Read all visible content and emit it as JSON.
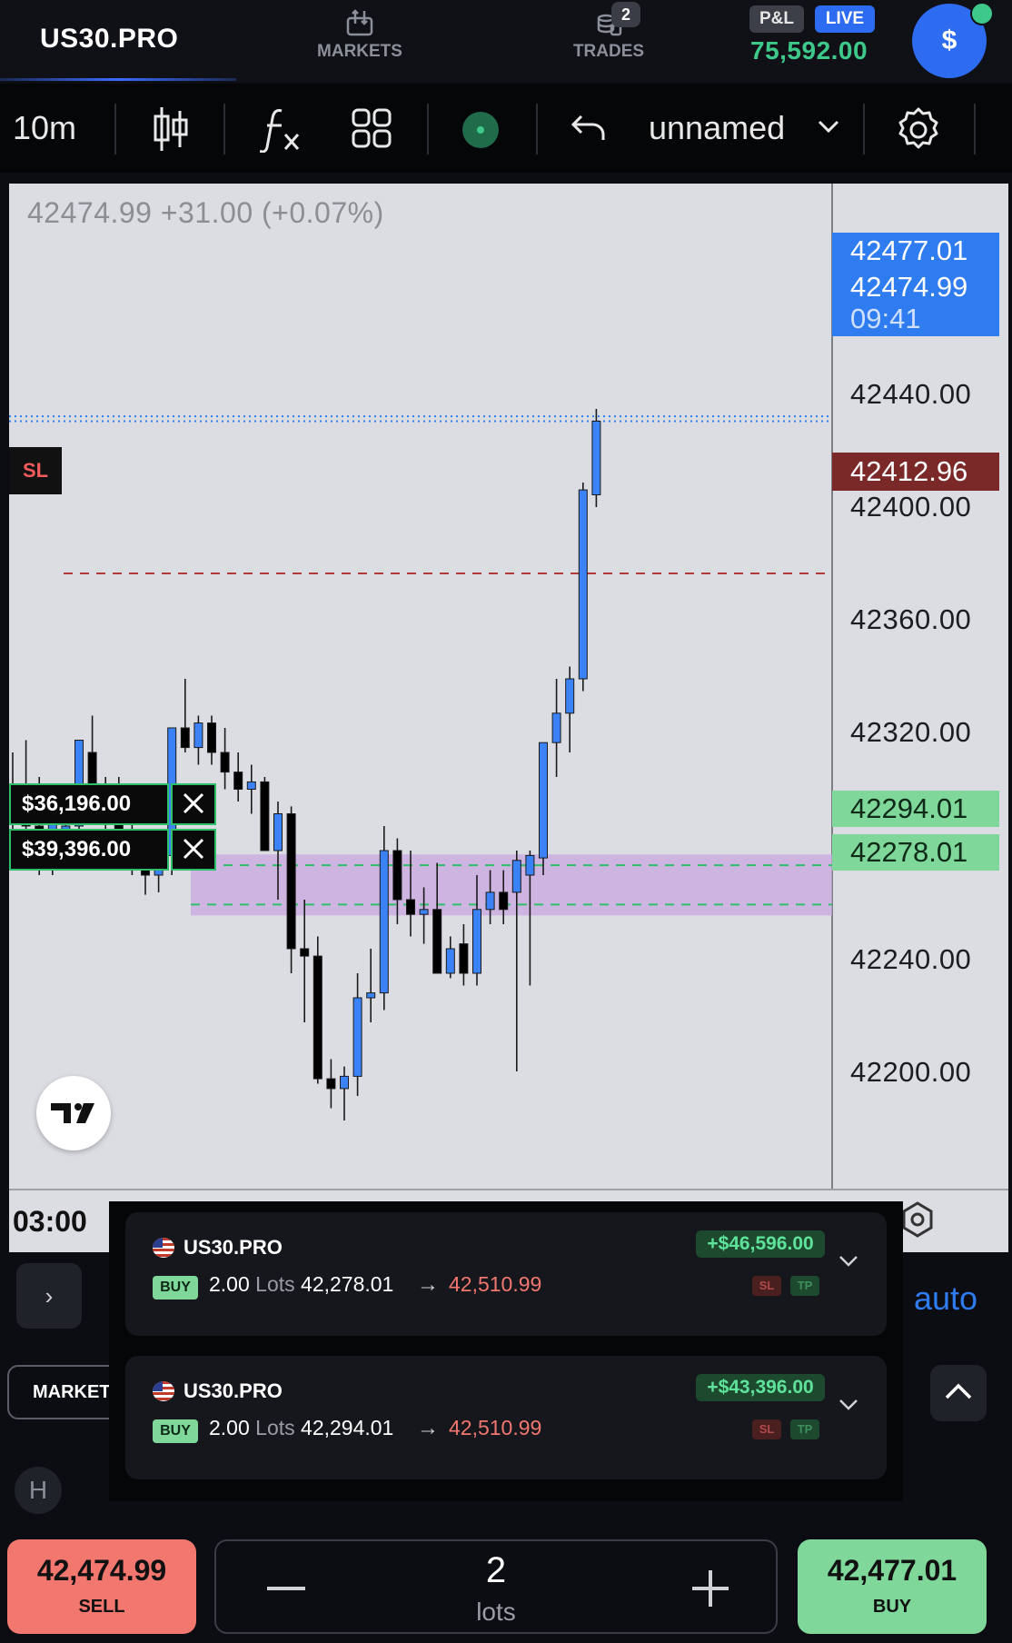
{
  "header": {
    "brand": "US30.PRO",
    "nav": [
      {
        "label": "MARKETS",
        "icon": "markets-icon"
      },
      {
        "label": "TRADES",
        "icon": "trades-icon",
        "badge": "2"
      }
    ],
    "pnl_label": "P&L",
    "live_label": "LIVE",
    "balance": "75,592.00",
    "account_symbol": "$"
  },
  "toolbar": {
    "interval": "10m",
    "layout_name": "unnamed"
  },
  "chart": {
    "quote_line": "42474.99 +31.00 (+0.07%)",
    "ask_price": "42477.01",
    "bid_price": "42474.99",
    "countdown": "09:41",
    "sl_price": "42412.96",
    "sl_label": "SL",
    "position_levels": [
      "42294.01",
      "42278.01"
    ],
    "position_pnl_labels": [
      "$36,196.00",
      "$39,396.00"
    ],
    "y_ticks": [
      "42440.00",
      "42400.00",
      "42360.00",
      "42320.00",
      "42240.00",
      "42200.00"
    ],
    "time_label": "03:00",
    "colors": {
      "up": "#3b82f6",
      "down": "#000000",
      "sl": "#b33a3a",
      "position": "#2fbf6b",
      "zone": "#c9a6e0"
    }
  },
  "positions": [
    {
      "symbol": "US30.PRO",
      "side": "BUY",
      "lots": "2.00",
      "lots_unit": "Lots",
      "entry": "42,278.01",
      "target": "42,510.99",
      "pnl": "+$46,596.00",
      "sl": "SL",
      "tp": "TP"
    },
    {
      "symbol": "US30.PRO",
      "side": "BUY",
      "lots": "2.00",
      "lots_unit": "Lots",
      "entry": "42,294.01",
      "target": "42,510.99",
      "pnl": "+$43,396.00",
      "sl": "SL",
      "tp": "TP"
    }
  ],
  "order_panel": {
    "expand_glyph": "›",
    "auto_label": "auto",
    "market_tab": "MARKET",
    "h_label": "H",
    "sell_price": "42,474.99",
    "sell_label": "SELL",
    "lots_value": "2",
    "lots_label": "lots",
    "buy_price": "42,477.01",
    "buy_label": "BUY"
  }
}
